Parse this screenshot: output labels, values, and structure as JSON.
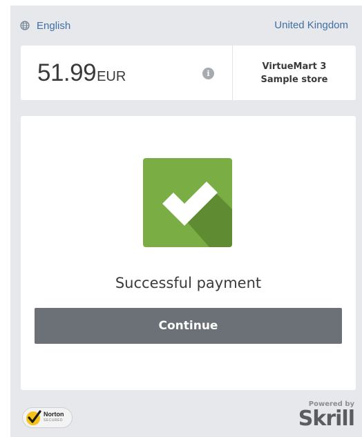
{
  "header": {
    "language": "English",
    "country": "United Kingdom",
    "icons": {
      "language": "globe-icon"
    }
  },
  "summary": {
    "amount": "51.99",
    "currency": "EUR",
    "merchant_line1": "VirtueMart 3",
    "merchant_line2": "Sample store",
    "info_icon": "i"
  },
  "result": {
    "status": "Successful payment",
    "continue_label": "Continue",
    "icon": "checkmark-icon",
    "accent_color": "#7aad43",
    "button_color": "#6c7077"
  },
  "footer": {
    "norton_brand": "Norton",
    "norton_sub": "SECURED",
    "powered_by": "Powered by",
    "provider": "Skrill"
  }
}
